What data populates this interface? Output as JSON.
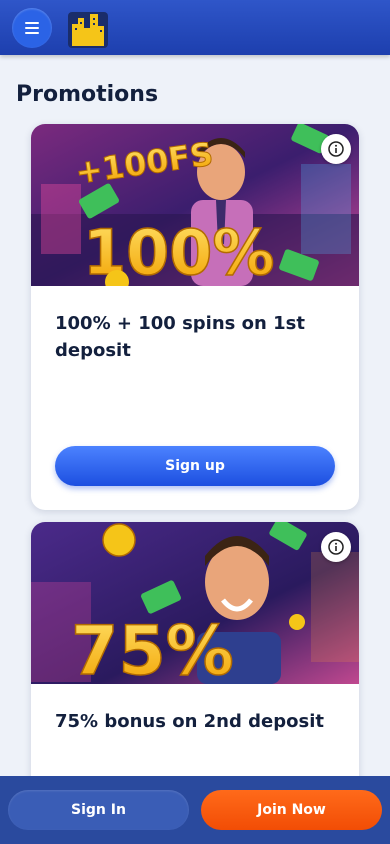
{
  "header": {
    "menu_icon": "hamburger-menu-icon",
    "logo_icon": "city-skyline-logo-icon"
  },
  "page": {
    "title": "Promotions"
  },
  "promotions": [
    {
      "banner_headline": "100%",
      "banner_badge": "+100FS",
      "title": "100% + 100 spins on 1st deposit",
      "button_label": "Sign up",
      "info_icon": "info-icon"
    },
    {
      "banner_headline": "75%",
      "title": "75% bonus on 2nd deposit",
      "info_icon": "info-icon"
    }
  ],
  "footer": {
    "signin_label": "Sign In",
    "join_label": "Join Now"
  },
  "colors": {
    "header_blue": "#1d3fae",
    "primary_button": "#2b63e6",
    "join_orange": "#f24d05",
    "title_text": "#13203d"
  }
}
